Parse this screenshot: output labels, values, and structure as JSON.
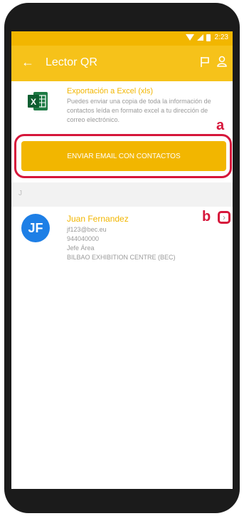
{
  "status_bar": {
    "time": "2:23"
  },
  "app_bar": {
    "back_icon": "arrow-left",
    "title": "Lector QR",
    "flag_icon": "flag",
    "profile_icon": "person"
  },
  "export": {
    "icon": "excel-icon",
    "title": "Exportación a Excel (xls)",
    "description": "Puedes enviar una copia de toda la información de contactos leída en formato excel a tu dirección de correo electrónico."
  },
  "send_button": {
    "label": "ENVIAR EMAIL CON CONTACTOS"
  },
  "annotations": {
    "a": "a",
    "b": "b",
    "color": "#d6173b"
  },
  "section": {
    "letter": "J"
  },
  "contact": {
    "initials": "JF",
    "name": "Juan Fernandez",
    "email": "jf123@bec.eu",
    "phone": "944040000",
    "role": "Jefe Área",
    "company": "BILBAO EXHIBITION CENTRE (BEC)"
  },
  "colors": {
    "accent": "#f2b600",
    "avatar": "#1e7fe6"
  }
}
